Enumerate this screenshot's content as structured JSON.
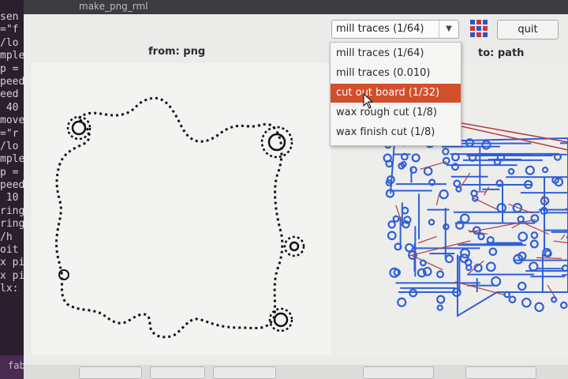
{
  "window": {
    "title": "make_png_rml"
  },
  "terminal": {
    "lines": [
      "sen",
      "=\"f",
      "/lo",
      "mple",
      "p =",
      "peed",
      "eed",
      " 40",
      "move",
      "=\"r",
      "/lo",
      "mple",
      "p =",
      "peed",
      " 10",
      "ring",
      "ring",
      "/h",
      "oit",
      "x pi",
      "x pi",
      "lx:",
      "",
      "",
      "",
      "",
      "fab"
    ]
  },
  "labels": {
    "from": "from: png",
    "to": "to: path"
  },
  "process_select": {
    "value": "mill traces (1/64)",
    "options": [
      "mill traces (1/64)",
      "mill traces (0.010)",
      "cut out board (1/32)",
      "wax rough cut (1/8)",
      "wax finish cut (1/8)"
    ],
    "highlighted_index": 2
  },
  "quit_label": "quit",
  "colors": {
    "highlight": "#d24f2c",
    "path_blue": "#2f5fd8",
    "path_red": "#b83a3a"
  }
}
